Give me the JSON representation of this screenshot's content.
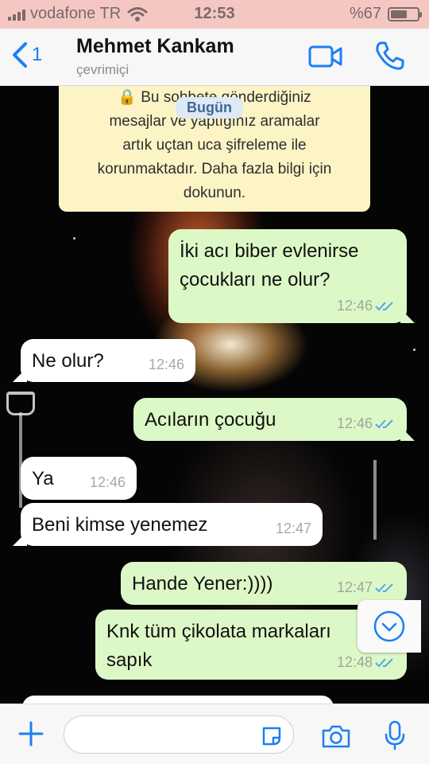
{
  "status_bar": {
    "carrier": "vodafone TR",
    "time": "12:53",
    "battery_text": "%67",
    "battery_level": 0.67
  },
  "header": {
    "back_count": "1",
    "contact_name": "Mehmet Kankam",
    "contact_status": "çevrimiçi"
  },
  "chat": {
    "encryption_notice": [
      "🔒 Bu sohbete gönderdiğiniz",
      "mesajlar ve yaptığınız aramalar",
      "artık uçtan uca şifreleme ile",
      "korunmaktadır. Daha fazla bilgi için",
      "dokunun."
    ],
    "date_badge": "Bugün",
    "messages": [
      {
        "direction": "out",
        "lines": [
          "İki acı biber evlenirse",
          "çocukları ne olur?"
        ],
        "time": "12:46",
        "read": true
      },
      {
        "direction": "in",
        "lines": [
          "Ne olur?"
        ],
        "time": "12:46"
      },
      {
        "direction": "out",
        "lines": [
          "Acıların çocuğu"
        ],
        "time": "12:46",
        "read": true
      },
      {
        "direction": "in",
        "lines": [
          "Ya"
        ],
        "time": "12:46"
      },
      {
        "direction": "in",
        "lines": [
          "Beni kimse yenemez"
        ],
        "time": "12:47"
      },
      {
        "direction": "out",
        "lines": [
          "Hande Yener:))))"
        ],
        "time": "12:47",
        "read": true
      },
      {
        "direction": "out",
        "lines": [
          "Knk tüm çikolata markaları",
          "sapık"
        ],
        "time": "12:48",
        "read": true
      }
    ]
  },
  "input": {
    "value": "",
    "placeholder": ""
  },
  "colors": {
    "accent": "#1a7ff5",
    "outgoing_bubble": "#dcf8c6",
    "incoming_bubble": "#ffffff",
    "read_ticks": "#4fa8e8",
    "status_bar_bg": "#f4c7c3"
  },
  "icons": {
    "back": "chevron-left-icon",
    "video": "video-camera-icon",
    "call": "phone-icon",
    "scroll": "chevron-down-circle-icon",
    "plus": "plus-icon",
    "sticker": "sticker-icon",
    "camera": "camera-icon",
    "mic": "microphone-icon"
  }
}
